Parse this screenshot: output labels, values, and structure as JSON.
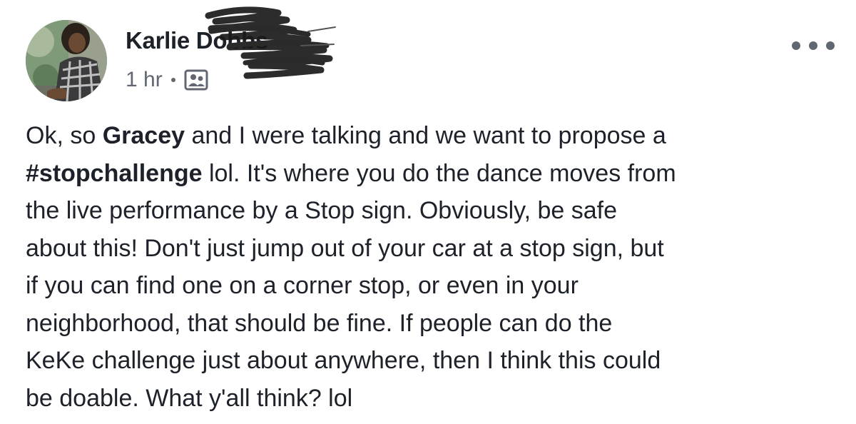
{
  "post": {
    "author": "Karlie Dobbs",
    "timestamp": "1 hr",
    "audience_icon": "friends-audience-icon",
    "more_icon": "more-options-icon",
    "body": {
      "l1_a": "Ok, so ",
      "l1_b": "Gracey",
      "l1_c": " and I were talking and we want to propose a",
      "l2_a": "#stopchallenge",
      "l2_b": " lol. It's where you do the dance moves from",
      "l3": "the live performance by a Stop sign. Obviously, be safe",
      "l4": "about this! Don't just jump out of your car at a stop sign, but",
      "l5": "if you can find one on a corner stop, or even in your",
      "l6": "neighborhood, that should be fine. If people can do the",
      "l7": "KeKe challenge just about anywhere, then I think this could",
      "l8": "be doable. What y'all think? lol"
    }
  },
  "colors": {
    "text_primary": "#1d2129",
    "text_secondary": "#606770",
    "background": "#ffffff"
  }
}
